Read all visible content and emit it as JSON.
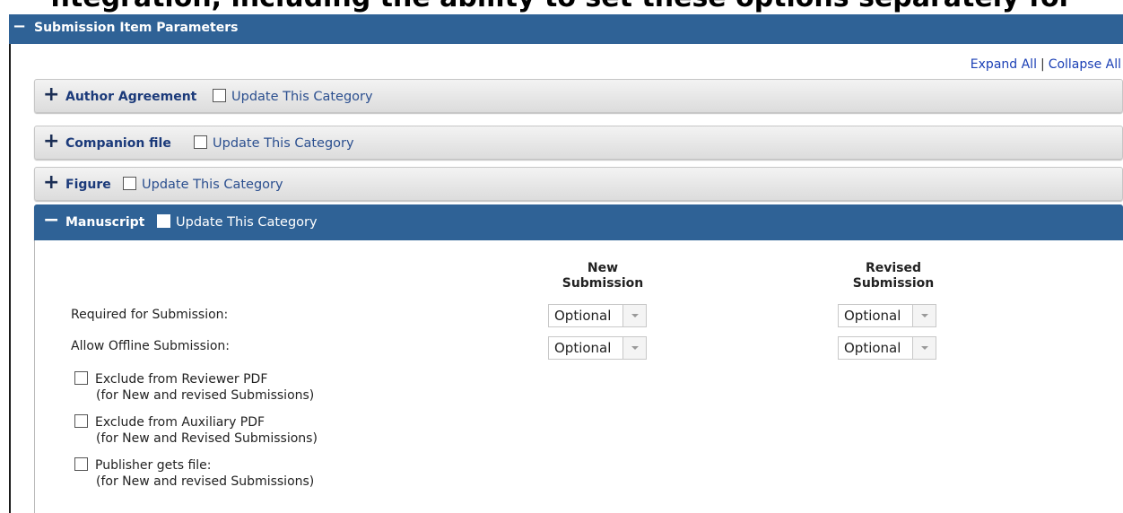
{
  "top_caption": "ntegration, including the ability to set these options separately for",
  "main_section": {
    "toggle": "−",
    "title": "Submission Item Parameters"
  },
  "links": {
    "expand_all": "Expand All",
    "separator": "|",
    "collapse_all": "Collapse All"
  },
  "categories": [
    {
      "toggle": "+",
      "name": "Author Agreement",
      "update_label": "Update This Category",
      "expanded": false
    },
    {
      "toggle": "+",
      "name": "Companion file",
      "update_label": "Update This Category",
      "expanded": false
    },
    {
      "toggle": "+",
      "name": "Figure",
      "update_label": "Update This Category",
      "expanded": false
    },
    {
      "toggle": "−",
      "name": "Manuscript",
      "update_label": "Update This Category",
      "expanded": true
    }
  ],
  "manuscript": {
    "columns": {
      "new": {
        "line1": "New",
        "line2": "Submission"
      },
      "revised": {
        "line1": "Revised",
        "line2": "Submission"
      }
    },
    "rows": [
      {
        "label": "Required for Submission:",
        "new_value": "Optional",
        "revised_value": "Optional"
      },
      {
        "label": "Allow Offline Submission:",
        "new_value": "Optional",
        "revised_value": "Optional"
      }
    ],
    "options": [
      {
        "label": "Exclude from Reviewer PDF",
        "note": "(for New and revised Submissions)",
        "checked": false
      },
      {
        "label": "Exclude from Auxiliary PDF",
        "note": "(for New and Revised Submissions)",
        "checked": false
      },
      {
        "label": "Publisher gets file:",
        "note": "(for New and revised Submissions)",
        "checked": false
      }
    ]
  }
}
